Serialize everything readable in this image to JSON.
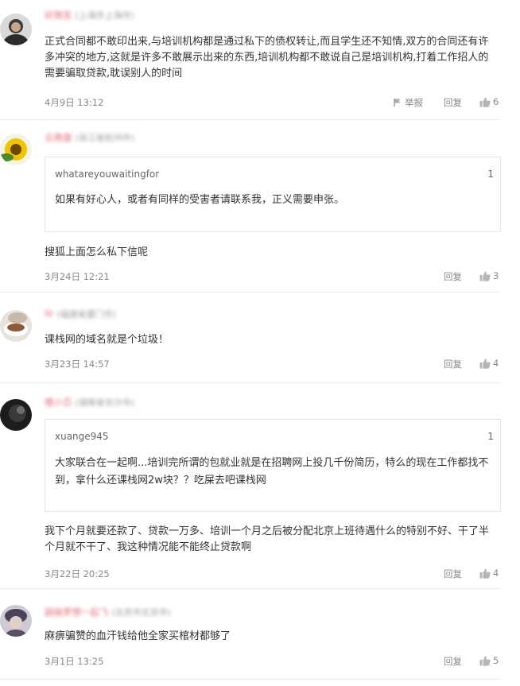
{
  "comments": [
    {
      "name": "好朋友",
      "location": "(上海市上海市)",
      "text": "正式合同都不敢印出来,与培训机构都是通过私下的债权转让,而且学生还不知情,双方的合同还有许多冲突的地方,这就是许多不敢展示出来的东西,培训机构都不敢说自己是培训机构,打着工作招人的需要骗取贷款,耽误别人的时间",
      "date": "4月9日 13:12",
      "report": "举报",
      "reply": "回复",
      "likes": "6"
    },
    {
      "name": "云南盘",
      "location": "(浙江省杭州市)",
      "quote": {
        "user": "whatareyouwaitingfor",
        "floor": "1",
        "text": "如果有好心人，或者有同样的受害者请联系我，正义需要申张。"
      },
      "text": "搜狐上面怎么私下信呢",
      "date": "3月24日 12:21",
      "reply": "回复",
      "likes": "3"
    },
    {
      "name": "叶",
      "location": "(福建省厦门市)",
      "text": "课栈网的域名就是个垃圾！",
      "date": "3月23日 14:57",
      "reply": "回复",
      "likes": "4"
    },
    {
      "name": "楼小芯",
      "location": "(湖南省长沙市)",
      "quote": {
        "user": "xuange945",
        "floor": "1",
        "text": "大家联合在一起啊...培训完所谓的包就业就是在招聘网上投几千份简历，特么的现在工作都找不到，拿什么还课栈网2w块？？吃屎去吧课栈网"
      },
      "text": "我下个月就要还款了、贷款一万多、培训一个月之后被分配北京上班待遇什么的特别不好、干了半个月就不干了、我这种情况能不能终止贷款啊",
      "date": "3月22日 20:25",
      "reply": "回复",
      "likes": "4"
    },
    {
      "name": "超级梦想一起飞",
      "location": "(北京市北京市)",
      "text": "麻痹骗赞的血汗钱给他全家买棺材都够了",
      "date": "3月1日 13:25",
      "reply": "回复",
      "likes": "5"
    }
  ]
}
